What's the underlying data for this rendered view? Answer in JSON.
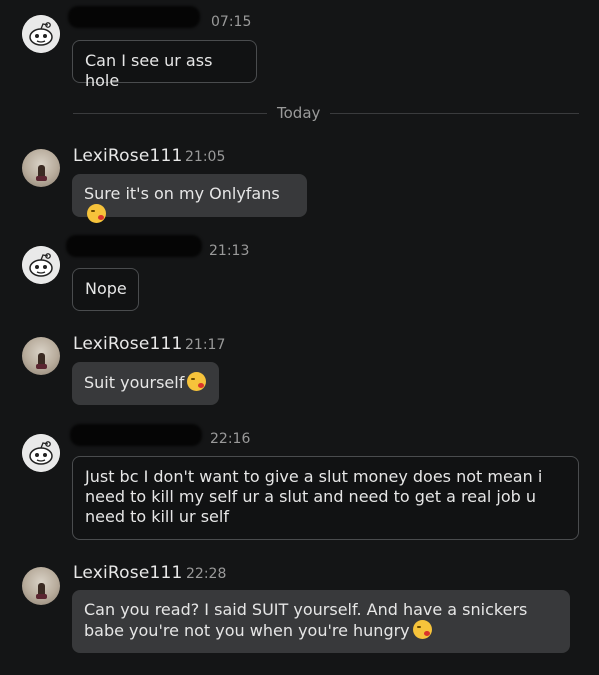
{
  "divider": {
    "label": "Today"
  },
  "messages": [
    {
      "sender": "",
      "time": "07:15",
      "text": "Can I see ur ass hole"
    },
    {
      "sender": "LexiRose111",
      "time": "21:05",
      "text": "Sure it's on my Onlyfans"
    },
    {
      "sender": "",
      "time": "21:13",
      "text": "Nope"
    },
    {
      "sender": "LexiRose111",
      "time": "21:17",
      "text": "Suit yourself"
    },
    {
      "sender": "",
      "time": "22:16",
      "text": "Just bc I don't want to give a slut money does not mean i need to kill my self ur a slut and need to get a real job u need to kill ur self"
    },
    {
      "sender": "LexiRose111",
      "time": "22:28",
      "text": "Can you read? I said SUIT yourself. And have a snickers babe you're not you when you're hungry"
    }
  ],
  "icons": {
    "user_avatar": "reddit-snoo-icon",
    "lexi_avatar": "profile-photo",
    "emoji": "kissing-face-emoji"
  }
}
